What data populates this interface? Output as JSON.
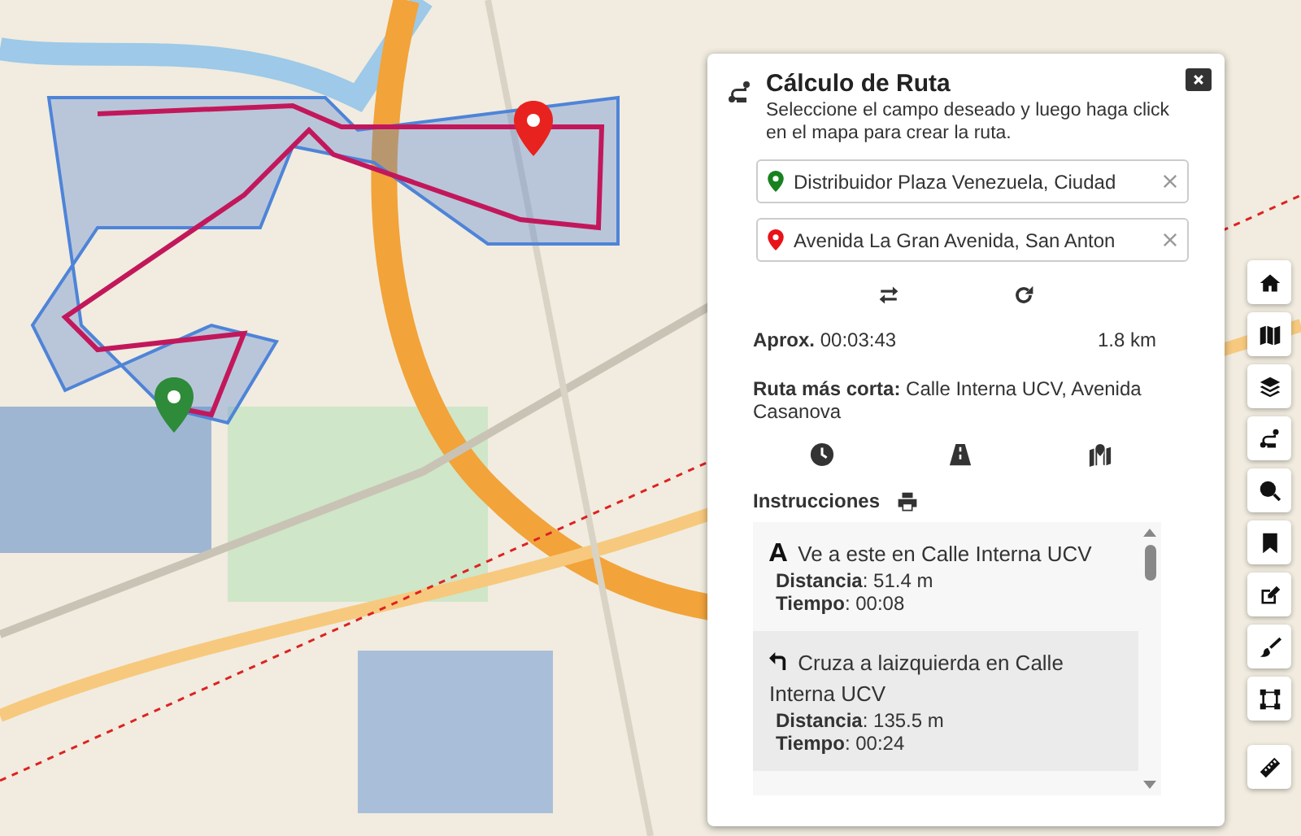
{
  "panel": {
    "title": "Cálculo de Ruta",
    "subtitle": "Seleccione el campo deseado y luego haga click en el mapa para crear la ruta.",
    "fields": [
      {
        "kind": "origin",
        "value": "Distribuidor Plaza Venezuela, Ciudad"
      },
      {
        "kind": "destination",
        "value": "Avenida La Gran Avenida, San Anton"
      }
    ],
    "approx_label": "Aprox.",
    "duration": "00:03:43",
    "distance": "1.8 km",
    "route_label": "Ruta más corta:",
    "route_value": "Calle Interna UCV, Avenida Casanova",
    "instructions_title": "Instrucciones",
    "instructions": [
      {
        "kind": "start",
        "selected": false,
        "text": "Ve a este en Calle Interna UCV",
        "distance": "**Distancia**: 51.4 m",
        "time": "**Tiempo**: 00:08"
      },
      {
        "kind": "left",
        "selected": true,
        "text": "Cruza a laizquierda en Calle Interna UCV",
        "distance": "**Distancia**: 135.5 m",
        "time": "**Tiempo**: 00:24"
      }
    ]
  },
  "toolbar": [
    {
      "kind": "home"
    },
    {
      "kind": "map"
    },
    {
      "kind": "layers"
    },
    {
      "kind": "route"
    },
    {
      "kind": "zoom"
    },
    {
      "kind": "bookmark"
    },
    {
      "kind": "edit"
    },
    {
      "kind": "brush"
    },
    {
      "kind": "polygon"
    },
    {
      "kind": "ruler"
    }
  ]
}
